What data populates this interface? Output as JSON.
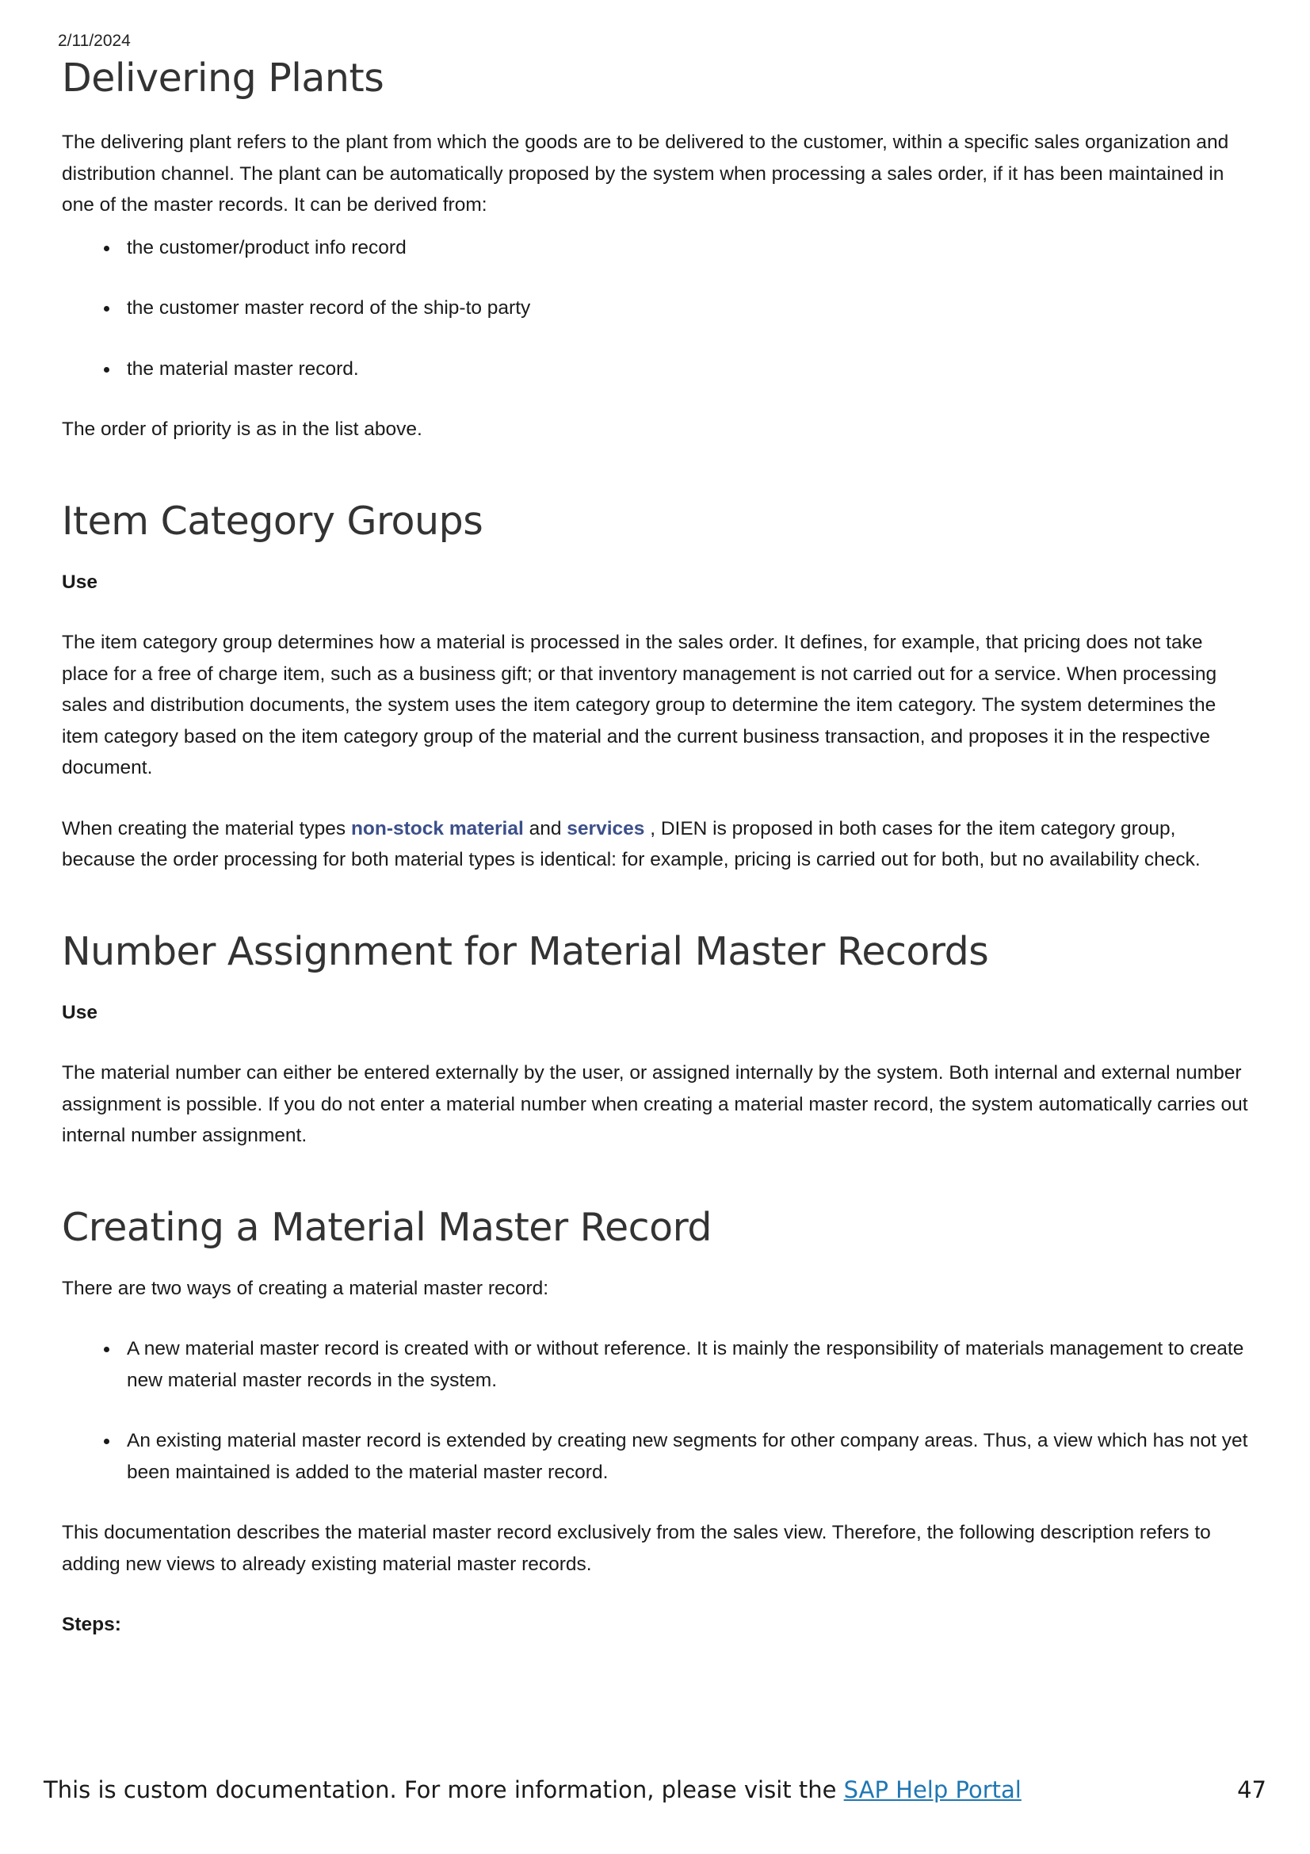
{
  "header": {
    "date": "2/11/2024"
  },
  "sections": {
    "delivering_plants": {
      "title": "Delivering Plants",
      "intro": "The delivering plant refers to the plant from which the goods are to be delivered to the customer, within a specific sales organization and distribution channel. The plant can be automatically proposed by the system when processing a sales order, if it has been maintained in one of the master records. It can be derived from:",
      "items": [
        "the customer/product info record",
        "the customer master record of the ship-to party",
        "the material master record."
      ],
      "outro": "The order of priority is as in the list above."
    },
    "item_category_groups": {
      "title": "Item Category Groups",
      "use_label": "Use",
      "para1": "The item category group determines how a material is processed in the sales order. It defines, for example, that pricing does not take place for a free of charge item, such as a business gift; or that inventory management is not carried out for a service. When processing sales and distribution documents, the system uses the item category group to determine the item category. The system determines the item category based on the item category group of the material and the current business transaction, and proposes it in the respective document.",
      "para2_before": "When creating the material types ",
      "para2_link1": "non-stock material",
      "para2_mid": " and ",
      "para2_link2": "services",
      "para2_after": " , DIEN is proposed in both cases for the item category group, because the order processing for both material types is identical: for example, pricing is carried out for both, but no availability check."
    },
    "number_assignment": {
      "title": "Number Assignment for Material Master Records",
      "use_label": "Use",
      "para1": "The material number can either be entered externally by the user, or assigned internally by the system. Both internal and external number assignment is possible. If you do not enter a material number when creating a material master record, the system automatically carries out internal number assignment."
    },
    "creating_record": {
      "title": "Creating a Material Master Record",
      "intro": "There are two ways of creating a material master record:",
      "items": [
        "A new material master record is created with or without reference. It is mainly the responsibility of materials management to create new material master records in the system.",
        "An existing material master record is extended by creating new segments for other company areas. Thus, a view which has not yet been maintained is added to the material master record."
      ],
      "para1": "This documentation describes the material master record exclusively from the sales view. Therefore, the following description refers to adding new views to already existing material master records.",
      "steps_label": "Steps:"
    }
  },
  "footer": {
    "text": "This is custom documentation. For more information, please visit the ",
    "link": "SAP Help Portal",
    "page_number": "47"
  }
}
